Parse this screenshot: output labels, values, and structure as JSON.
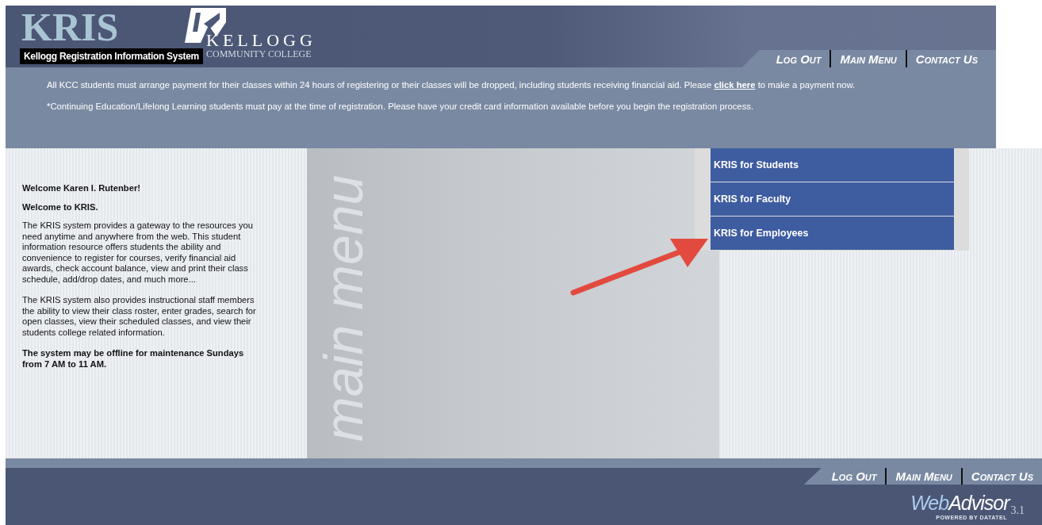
{
  "header": {
    "logo": {
      "title": "KRIS",
      "subtitle": "Kellogg Registration Information System"
    },
    "college": {
      "name": "KELLOGG",
      "subname": "COMMUNITY COLLEGE"
    },
    "nav": [
      "Log Out",
      "Main Menu",
      "Contact Us"
    ],
    "notices": [
      {
        "before": "All KCC students must arrange payment for their classes within 24 hours of registering or their classes will be dropped, including students receiving financial aid. Please",
        "link": "click here",
        "after": "to make a payment now."
      },
      {
        "before": "*Continuing Education/Lifelong Learning students must pay at the time of registration. Please have your credit card information available before you begin the registration process."
      }
    ]
  },
  "welcome": [
    {
      "text": "Welcome Karen I. Rutenber!",
      "bold": true
    },
    {
      "text": "Welcome to KRIS.",
      "bold": true
    },
    {
      "text": "The KRIS system provides a gateway to the resources you need anytime and anywhere from the web. This student information resource offers students the ability and convenience to register for courses, verify financial aid awards, check account balance, view and print their class schedule, add/drop dates, and much more...",
      "bold": false
    },
    {
      "text": "The KRIS system also provides instructional staff members the ability to view their class roster, enter grades, search for open classes, view their scheduled classes, and view their students college related information.",
      "bold": false
    },
    {
      "text": "The system may be offline for maintenance Sundays from 7 AM to 11 AM.",
      "bold": true
    }
  ],
  "main_menu_label": "main menu",
  "menu": [
    "KRIS for Students",
    "KRIS for Faculty",
    "KRIS for Employees"
  ],
  "footer": {
    "nav": [
      "Log Out",
      "Main Menu",
      "Contact Us"
    ],
    "brand": {
      "part_1": "Web",
      "part_2": "Advisor",
      "version": "3.1",
      "tagline": "POWERED BY DATATEL"
    }
  }
}
